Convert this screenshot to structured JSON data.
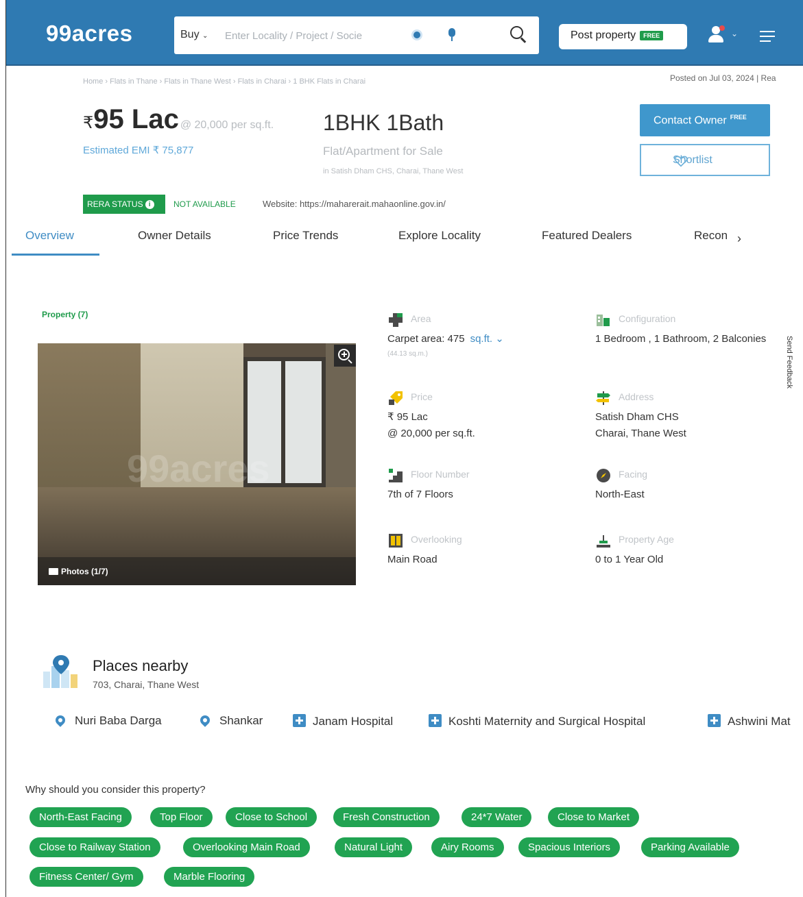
{
  "header": {
    "logo": "99acres",
    "buy_label": "Buy",
    "search_placeholder": "Enter Locality / Project / Socie",
    "post_property_label": "Post property",
    "post_property_badge": "FREE"
  },
  "breadcrumb": "Home › Flats in Thane › Flats in Thane West › Flats in Charai › 1 BHK Flats in Charai",
  "posted": "Posted on Jul 03, 2024  |  Rea",
  "price": {
    "currency": "₹",
    "amount": "95 Lac",
    "per_sqft": "@ 20,000 per sq.ft.",
    "emi": "Estimated EMI ₹ 75,877"
  },
  "listing": {
    "bhk": "1BHK 1Bath",
    "type": "Flat/Apartment for Sale",
    "location": "in Satish Dham CHS, Charai, Thane West"
  },
  "actions": {
    "contact_owner": "Contact Owner",
    "contact_badge": "FREE",
    "shortlist": "Shortlist"
  },
  "rera": {
    "badge": "RERA STATUS",
    "info": "i",
    "status": "NOT AVAILABLE",
    "website": "Website: https://maharerait.mahaonline.gov.in/"
  },
  "tabs": [
    "Overview",
    "Owner Details",
    "Price Trends",
    "Explore Locality",
    "Featured Dealers",
    "Recon"
  ],
  "gallery": {
    "label": "Property (7)",
    "watermark": "99acres",
    "photos_label": "Photos (1/7)"
  },
  "facts": {
    "area_label": "Area",
    "area_value": "Carpet area: 475",
    "area_unit": "sq.ft.",
    "area_sqm": "(44.13 sq.m.)",
    "config_label": "Configuration",
    "config_value": "1 Bedroom , 1 Bathroom, 2 Balconies",
    "price_label": "Price",
    "price_value_1": "₹ 95 Lac",
    "price_value_2": "@ 20,000 per sq.ft.",
    "address_label": "Address",
    "address_value_1": "Satish Dham CHS",
    "address_value_2": "Charai, Thane West",
    "floor_label": "Floor Number",
    "floor_value": "7th  of 7 Floors",
    "facing_label": "Facing",
    "facing_value": "North-East",
    "overlooking_label": "Overlooking",
    "overlooking_value": "Main Road",
    "age_label": "Property Age",
    "age_value": "0 to 1 Year Old"
  },
  "places": {
    "title": "Places nearby",
    "address": "703, Charai, Thane West",
    "items": [
      "Nuri Baba Darga",
      "Shankar",
      "Janam Hospital",
      "Koshti Maternity and Surgical Hospital",
      "Ashwini Mat"
    ]
  },
  "why": {
    "title": "Why should you consider this property?",
    "tags": [
      "North-East Facing",
      "Top Floor",
      "Close to School",
      "Fresh Construction",
      "24*7 Water",
      "Close to Market",
      "Close to Railway Station",
      "Overlooking Main Road",
      "Natural Light",
      "Airy Rooms",
      "Spacious Interiors",
      "Parking Available",
      "Fitness Center/ Gym",
      "Marble Flooring"
    ]
  },
  "side_feedback": "Send Feedback",
  "colors": {
    "brand": "#2f7ab2",
    "accent_green": "#21a352",
    "link_blue": "#3f8cc4"
  }
}
